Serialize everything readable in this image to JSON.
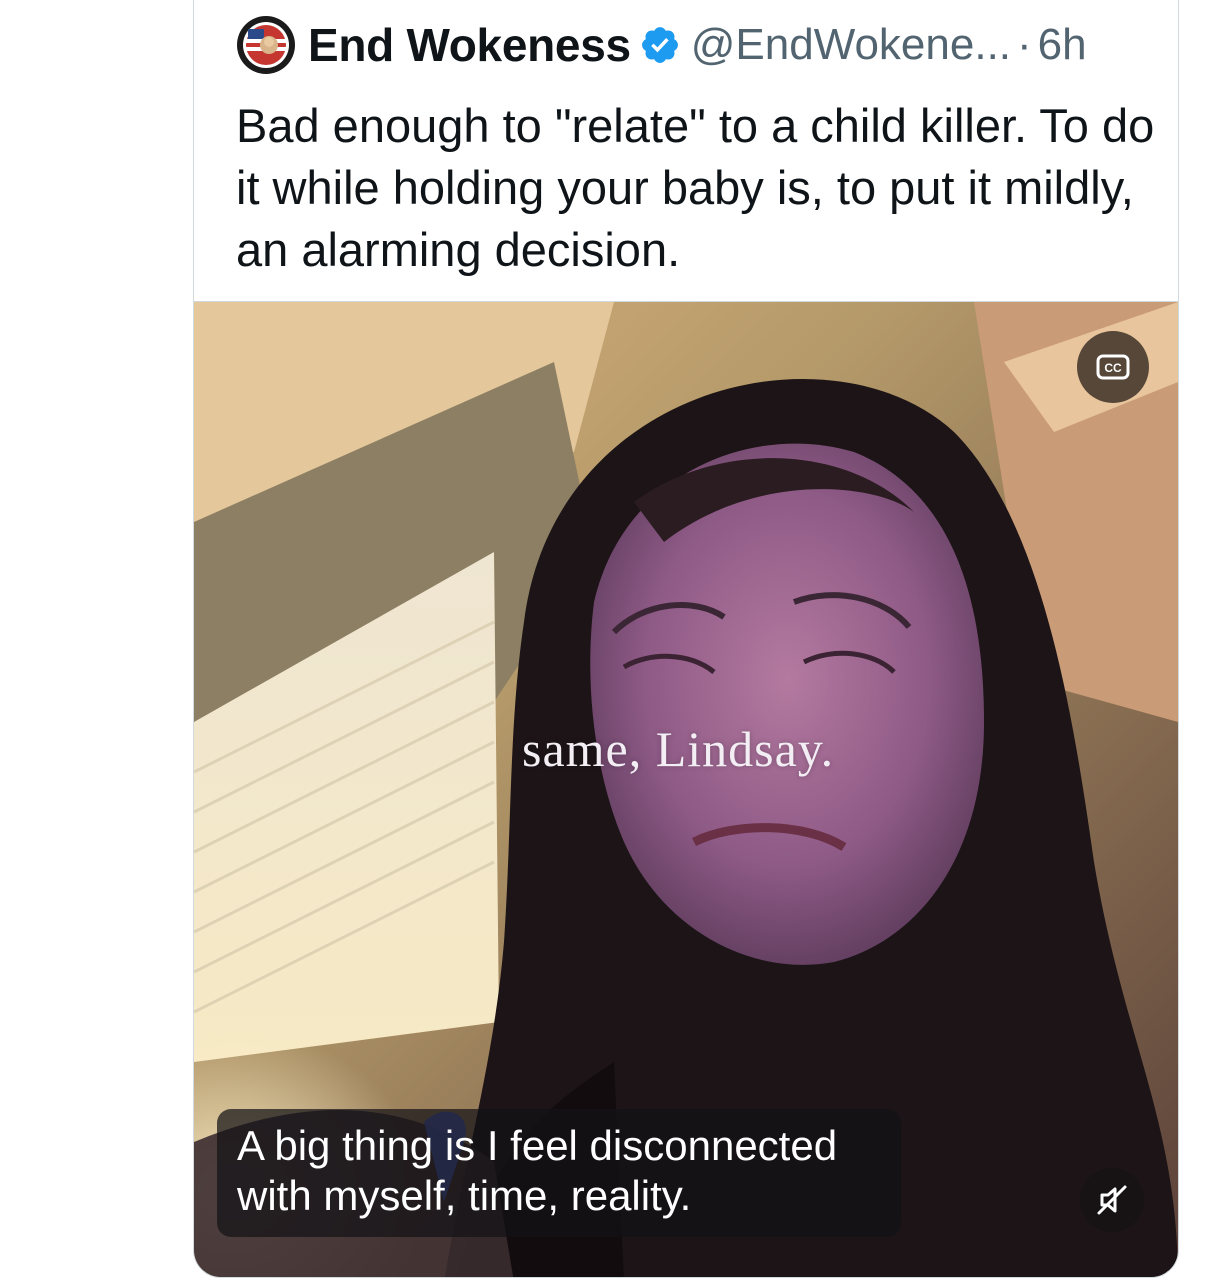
{
  "tweet": {
    "display_name": "End Wokeness",
    "handle": "@EndWokene...",
    "separator": "·",
    "timestamp": "6h",
    "text": "Bad enough to \"relate\" to a child killer. To do it while holding your baby is, to put it mildly, an alarming decision.",
    "verified": true
  },
  "media": {
    "overlay_text": "same, Lindsay.",
    "subtitle_line_1": "A big thing is I feel disconnected",
    "subtitle_line_2": "with myself, time, reality.",
    "cc_label": "CC"
  },
  "icons": {
    "verified": "verified-badge-icon",
    "captions": "closed-captions-icon",
    "mute": "volume-muted-icon",
    "avatar": "avatar-emblem-icon"
  },
  "colors": {
    "name": "#0f1419",
    "secondary": "#536471",
    "verified": "#1d9bf0",
    "border": "#cfd9de"
  }
}
